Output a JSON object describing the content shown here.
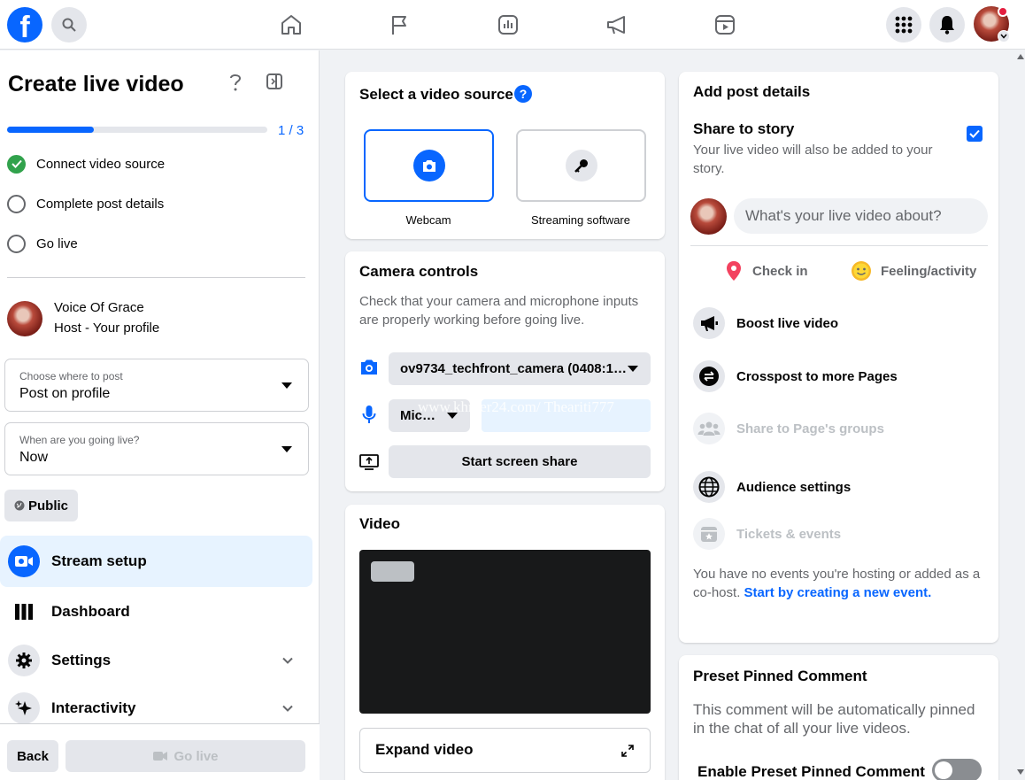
{
  "topbar": {
    "logo": "f",
    "nav_icons": [
      "home-icon",
      "flag-icon",
      "insights-icon",
      "megaphone-icon",
      "video-icon"
    ]
  },
  "sidebar": {
    "title": "Create live video",
    "progress": {
      "text": "1 / 3",
      "fraction": 0.333
    },
    "steps": [
      {
        "label": "Connect video source",
        "done": true
      },
      {
        "label": "Complete post details",
        "done": false
      },
      {
        "label": "Go live",
        "done": false
      }
    ],
    "profile": {
      "name": "Voice Of Grace",
      "sub": "Host - Your profile"
    },
    "post_where": {
      "label": "Choose where to post",
      "value": "Post on profile"
    },
    "when_live": {
      "label": "When are you going live?",
      "value": "Now"
    },
    "audience": "Public",
    "menu": [
      {
        "label": "Stream setup"
      },
      {
        "label": "Dashboard"
      },
      {
        "label": "Settings"
      },
      {
        "label": "Interactivity"
      }
    ],
    "back_label": "Back",
    "go_live_label": "Go live"
  },
  "video_source": {
    "title": "Select a video source",
    "options": [
      {
        "label": "Webcam",
        "selected": true
      },
      {
        "label": "Streaming software",
        "selected": false
      }
    ]
  },
  "camera_controls": {
    "title": "Camera controls",
    "description": "Check that your camera and microphone inputs are properly working before going live.",
    "camera_value": "ov9734_techfront_camera (0408:1…",
    "mic_value": "Mic…",
    "watermark": "www.khmer24.com/ Theariti777",
    "screen_share_label": "Start screen share"
  },
  "video_card": {
    "title": "Video",
    "expand_label": "Expand video"
  },
  "post_details": {
    "title": "Add post details",
    "share_story_title": "Share to story",
    "share_story_desc": "Your live video will also be added to your story.",
    "share_story_checked": true,
    "input_placeholder": "What's your live video about?",
    "check_in": "Check in",
    "feeling": "Feeling/activity",
    "actions": [
      {
        "label": "Boost live video",
        "enabled": true
      },
      {
        "label": "Crosspost to more Pages",
        "enabled": true
      },
      {
        "label": "Share to Page's groups",
        "enabled": false
      },
      {
        "label": "Audience settings",
        "enabled": true
      },
      {
        "label": "Tickets & events",
        "enabled": false
      }
    ],
    "events_text": "You have no events you're hosting or added as a co-host.",
    "events_link": "Start by creating a new event."
  },
  "pinned_comment": {
    "title": "Preset Pinned Comment",
    "description": "This comment will be automatically pinned in the chat of all your live videos.",
    "toggle_label": "Enable Preset Pinned Comment",
    "toggle_on": false
  },
  "colors": {
    "accent": "#0866ff",
    "success": "#31a24c",
    "notification": "#e41e3f"
  }
}
